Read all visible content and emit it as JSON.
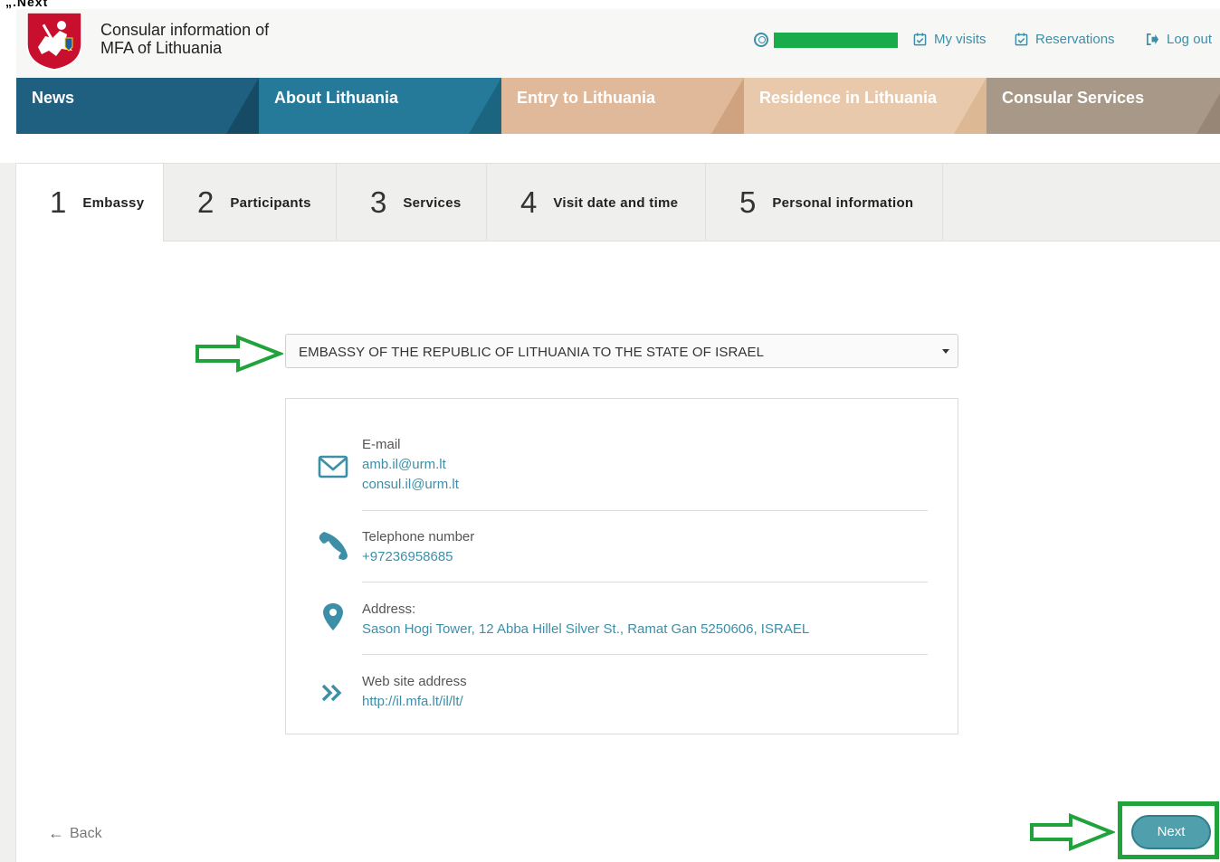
{
  "top_strip": {
    "text": "„.Next"
  },
  "header": {
    "brand_line1": "Consular information of",
    "brand_line2": "MFA of Lithuania",
    "links": [
      {
        "label": "My visits",
        "icon": "calendar-check-icon"
      },
      {
        "label": "Reservations",
        "icon": "calendar-check-icon"
      },
      {
        "label": "Log out",
        "icon": "log-out-icon"
      }
    ]
  },
  "nav": [
    {
      "label": "News",
      "color": "#1f5f7f"
    },
    {
      "label": "About Lithuania",
      "color": "#247a98"
    },
    {
      "label": "Entry to Lithuania",
      "color": "#dfb999"
    },
    {
      "label": "Residence in Lithuania",
      "color": "#e8c9ac"
    },
    {
      "label": "Consular Services",
      "color": "#a89888"
    }
  ],
  "steps": [
    {
      "num": "1",
      "label": "Embassy"
    },
    {
      "num": "2",
      "label": "Participants"
    },
    {
      "num": "3",
      "label": "Services"
    },
    {
      "num": "4",
      "label": "Visit date and time"
    },
    {
      "num": "5",
      "label": "Personal information"
    }
  ],
  "embassy_select": {
    "value": "EMBASSY OF THE REPUBLIC OF LITHUANIA TO THE STATE OF ISRAEL"
  },
  "info": {
    "email_label": "E-mail",
    "email_1": "amb.il@urm.lt",
    "email_2": "consul.il@urm.lt",
    "phone_label": "Telephone number",
    "phone": "+97236958685",
    "address_label": "Address:",
    "address": "Sason Hogi Tower, 12 Abba Hillel Silver St., Ramat Gan 5250606, ISRAEL",
    "web_label": "Web site address",
    "web": "http://il.mfa.lt/il/lt/"
  },
  "footer": {
    "back_label": "Back",
    "next_label": "Next"
  },
  "colors": {
    "accent": "#3d8fa8",
    "annotation_green": "#1fa33a",
    "button": "#4f9fad"
  }
}
